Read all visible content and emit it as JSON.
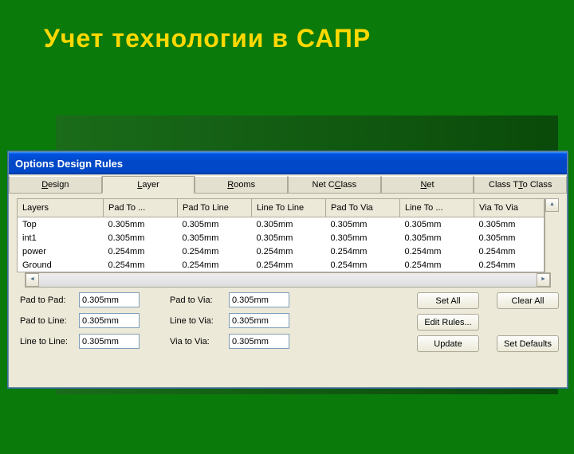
{
  "slide_title": "Учет технологии в САПР",
  "titlebar": "Options Design Rules",
  "tabs": {
    "design": "esign",
    "layer": "ayer",
    "rooms": "ooms",
    "netclass": "lass",
    "net": "et",
    "classtoclass": "o Class"
  },
  "tab_prefix": {
    "design": "D",
    "layer": "L",
    "rooms": "R",
    "netclass": "Net C",
    "net": "N",
    "classtoclass": "Class T"
  },
  "columns": [
    "Layers",
    "Pad To ...",
    "Pad To Line",
    "Line To Line",
    "Pad To Via",
    "Line To ...",
    "Via To Via"
  ],
  "rows": [
    {
      "layer": "Top",
      "v": [
        "0.305mm",
        "0.305mm",
        "0.305mm",
        "0.305mm",
        "0.305mm",
        "0.305mm"
      ]
    },
    {
      "layer": "int1",
      "v": [
        "0.305mm",
        "0.305mm",
        "0.305mm",
        "0.305mm",
        "0.305mm",
        "0.305mm"
      ]
    },
    {
      "layer": "power",
      "v": [
        "0.254mm",
        "0.254mm",
        "0.254mm",
        "0.254mm",
        "0.254mm",
        "0.254mm"
      ]
    },
    {
      "layer": "Ground",
      "v": [
        "0.254mm",
        "0.254mm",
        "0.254mm",
        "0.254mm",
        "0.254mm",
        "0.254mm"
      ]
    }
  ],
  "form": {
    "pad_to_pad": {
      "label": "Pad to Pad:",
      "value": "0.305mm"
    },
    "pad_to_line": {
      "label": "Pad to Line:",
      "value": "0.305mm"
    },
    "line_to_line": {
      "label": "Line to Line:",
      "value": "0.305mm"
    },
    "pad_to_via": {
      "label": "Pad to Via:",
      "value": "0.305mm"
    },
    "line_to_via": {
      "label": "Line to Via:",
      "value": "0.305mm"
    },
    "via_to_via": {
      "label": "Via to Via:",
      "value": "0.305mm"
    }
  },
  "buttons": {
    "set_all": "Set All",
    "clear_all": "Clear All",
    "edit_rules": "Edit Rules...",
    "update": "Update",
    "set_defaults": "Set Defaults"
  },
  "scroll_chars": {
    "left": "◄",
    "right": "►",
    "up": "▲",
    "down": "▼"
  }
}
